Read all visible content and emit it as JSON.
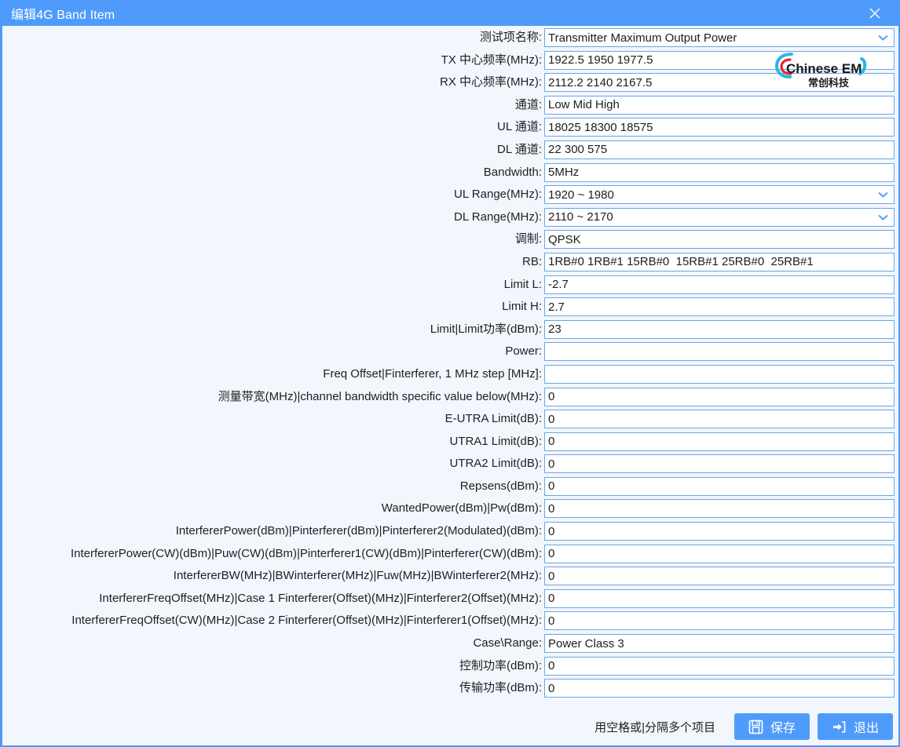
{
  "window": {
    "title": "编辑4G Band Item",
    "close_icon": "close-icon",
    "accent_color": "#4f9bfb",
    "background_color": "#f2f6fd",
    "field_border_color": "#6ba6e8"
  },
  "watermark": {
    "text": "Chinese EMC",
    "subtext": "常创科技",
    "colors": {
      "arc_cyan": "#29b6e8",
      "letter_red": "#e8232a",
      "text_black": "#1a1a1a"
    }
  },
  "fields": [
    {
      "label": "测试项名称:",
      "value": "Transmitter Maximum Output Power",
      "type": "combo",
      "name": "test-item-name"
    },
    {
      "label": "TX 中心频率(MHz):",
      "value": "1922.5 1950 1977.5",
      "type": "text",
      "name": "tx-center-frequency"
    },
    {
      "label": "RX 中心频率(MHz):",
      "value": "2112.2 2140 2167.5",
      "type": "text",
      "name": "rx-center-frequency"
    },
    {
      "label": "通道:",
      "value": "Low Mid High",
      "type": "text",
      "name": "channel"
    },
    {
      "label": "UL 通道:",
      "value": "18025 18300 18575",
      "type": "text",
      "name": "ul-channel"
    },
    {
      "label": "DL 通道:",
      "value": "22 300 575",
      "type": "text",
      "name": "dl-channel"
    },
    {
      "label": "Bandwidth:",
      "value": "5MHz",
      "type": "text",
      "name": "bandwidth"
    },
    {
      "label": "UL Range(MHz):",
      "value": "1920 ~ 1980",
      "type": "combo",
      "name": "ul-range"
    },
    {
      "label": "DL Range(MHz):",
      "value": "2110 ~ 2170",
      "type": "combo",
      "name": "dl-range"
    },
    {
      "label": "调制:",
      "value": "QPSK",
      "type": "text",
      "name": "modulation"
    },
    {
      "label": "RB:",
      "value": "1RB#0 1RB#1 15RB#0  15RB#1 25RB#0  25RB#1",
      "type": "text",
      "name": "rb"
    },
    {
      "label": "Limit L:",
      "value": "-2.7",
      "type": "text",
      "name": "limit-l"
    },
    {
      "label": "Limit H:",
      "value": "2.7",
      "type": "text",
      "name": "limit-h"
    },
    {
      "label": "Limit|Limit功率(dBm):",
      "value": "23",
      "type": "text",
      "name": "limit-power-dbm"
    },
    {
      "label": "Power:",
      "value": "",
      "type": "text",
      "name": "power"
    },
    {
      "label": "Freq Offset|Finterferer, 1 MHz step [MHz]:",
      "value": "",
      "type": "text",
      "name": "freq-offset"
    },
    {
      "label": "测量带宽(MHz)|channel bandwidth specific value below(MHz):",
      "value": "0",
      "type": "text",
      "name": "measurement-bandwidth"
    },
    {
      "label": "E-UTRA Limit(dB):",
      "value": "0",
      "type": "text",
      "name": "e-utra-limit"
    },
    {
      "label": "UTRA1 Limit(dB):",
      "value": "0",
      "type": "text",
      "name": "utra1-limit"
    },
    {
      "label": "UTRA2 Limit(dB):",
      "value": "0",
      "type": "text",
      "name": "utra2-limit"
    },
    {
      "label": "Repsens(dBm):",
      "value": "0",
      "type": "text",
      "name": "repsens"
    },
    {
      "label": "WantedPower(dBm)|Pw(dBm):",
      "value": "0",
      "type": "text",
      "name": "wanted-power"
    },
    {
      "label": "InterfererPower(dBm)|Pinterferer(dBm)|Pinterferer2(Modulated)(dBm):",
      "value": "0",
      "type": "text",
      "name": "interferer-power"
    },
    {
      "label": "InterfererPower(CW)(dBm)|Puw(CW)(dBm)|Pinterferer1(CW)(dBm)|Pinterferer(CW)(dBm):",
      "value": "0",
      "type": "text",
      "name": "interferer-power-cw"
    },
    {
      "label": "InterfererBW(MHz)|BWinterferer(MHz)|Fuw(MHz)|BWinterferer2(MHz):",
      "value": "0",
      "type": "text",
      "name": "interferer-bw"
    },
    {
      "label": "InterfererFreqOffset(MHz)|Case 1 Finterferer(Offset)(MHz)|Finterferer2(Offset)(MHz):",
      "value": "0",
      "type": "text",
      "name": "interferer-freq-offset"
    },
    {
      "label": "InterfererFreqOffset(CW)(MHz)|Case 2 Finterferer(Offset)(MHz)|Finterferer1(Offset)(MHz):",
      "value": "0",
      "type": "text",
      "name": "interferer-freq-offset-cw"
    },
    {
      "label": "Case\\Range:",
      "value": "Power Class 3",
      "type": "text",
      "name": "case-range"
    },
    {
      "label": "控制功率(dBm):",
      "value": "0",
      "type": "text",
      "name": "control-power"
    },
    {
      "label": "传输功率(dBm):",
      "value": "0",
      "type": "text",
      "name": "transmit-power"
    }
  ],
  "footer": {
    "hint": "用空格或|分隔多个项目",
    "save_label": "保存",
    "exit_label": "退出",
    "save_icon": "floppy-disk-icon",
    "exit_icon": "exit-arrow-icon"
  }
}
